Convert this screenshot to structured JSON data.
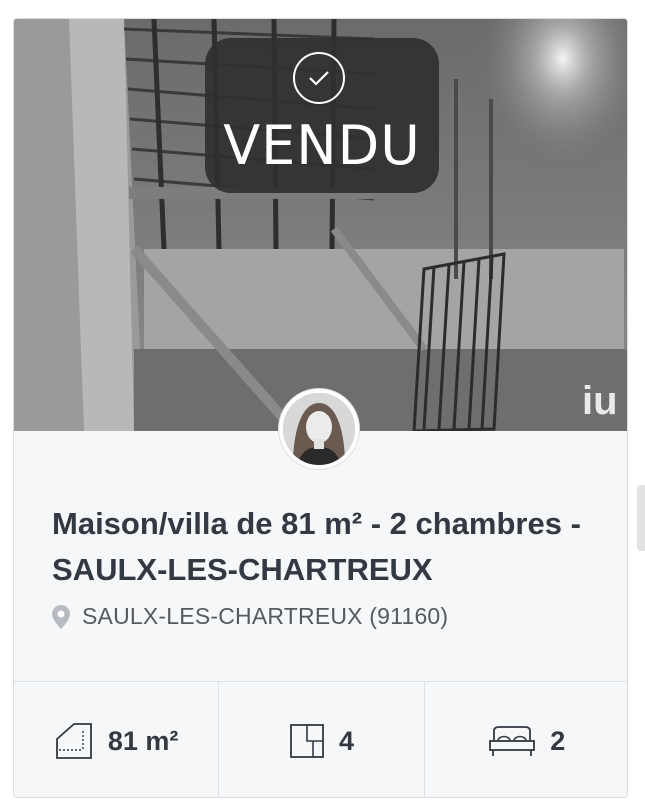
{
  "listing": {
    "status_label": "VENDU",
    "title": "Maison/villa de 81 m² - 2 chambres - SAULX-LES-CHARTREUX",
    "location": "SAULX-LES-CHARTREUX (91160)",
    "features": {
      "surface": "81 m²",
      "rooms": "4",
      "bedrooms": "2"
    }
  },
  "icons": {
    "status": "check-circle-icon",
    "location": "map-pin-icon",
    "surface": "surface-area-icon",
    "rooms": "floor-plan-icon",
    "bedrooms": "bed-icon"
  },
  "colors": {
    "badge_bg": "#303030",
    "title": "#333942",
    "card_bg": "#f6f7f9",
    "pin": "#b8bcc2"
  }
}
